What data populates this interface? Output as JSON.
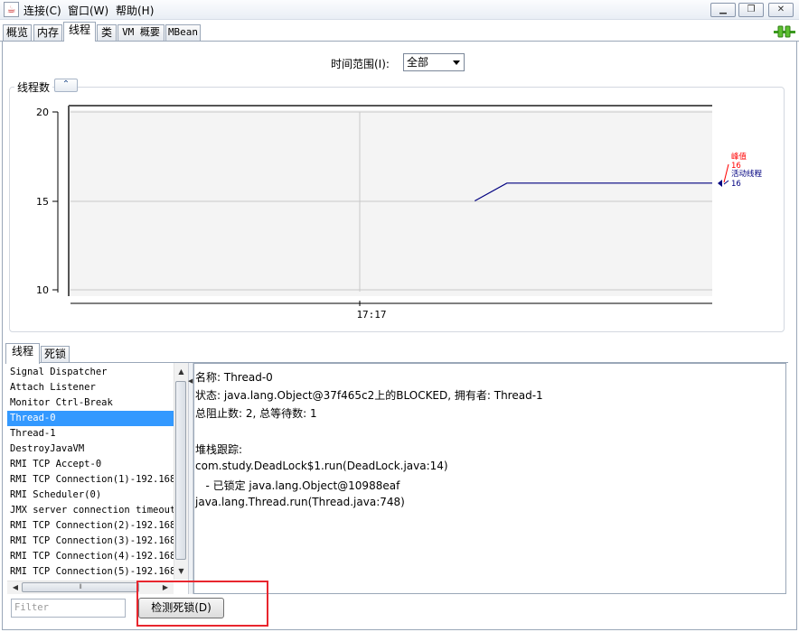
{
  "menubar": {
    "java_icon": "java-cup-icon",
    "items": [
      "连接(C)",
      "窗口(W)",
      "帮助(H)"
    ],
    "window_buttons": {
      "minimize": "▁",
      "restore": "❐",
      "close": "✕"
    }
  },
  "tabs": [
    "概览",
    "内存",
    "线程",
    "类",
    "VM 概要",
    "MBean"
  ],
  "active_tab": "线程",
  "connection_icon": "plug-connected-icon",
  "time_range": {
    "label": "时间范围(I):",
    "value": "全部"
  },
  "chart_panel": {
    "title": "线程数",
    "collapse_icon": "double-chevron-up-icon"
  },
  "chart_data": {
    "type": "line",
    "y_ticks": [
      "20",
      "15",
      "10"
    ],
    "x_ticks": [
      "17:17"
    ],
    "ylim": [
      10,
      20
    ],
    "series": [
      {
        "name": "峰值",
        "value": "16",
        "color": "#ff0000",
        "x": [],
        "y": []
      },
      {
        "name": "活动线程",
        "value": "16",
        "color": "#000080",
        "x": [
          0.63,
          0.68,
          1.0
        ],
        "y": [
          15,
          16,
          16
        ]
      }
    ]
  },
  "bottom_tabs": [
    "线程",
    "死锁"
  ],
  "active_bottom_tab": "线程",
  "threads": [
    "Signal Dispatcher",
    "Attach Listener",
    "Monitor Ctrl-Break",
    "Thread-0",
    "Thread-1",
    "DestroyJavaVM",
    "RMI TCP Accept-0",
    "RMI TCP Connection(1)-192.168.",
    "RMI Scheduler(0)",
    "JMX server connection timeout",
    "RMI TCP Connection(2)-192.168.",
    "RMI TCP Connection(3)-192.168.",
    "RMI TCP Connection(4)-192.168.",
    "RMI TCP Connection(5)-192.168."
  ],
  "selected_thread": "Thread-0",
  "details": {
    "name": "名称: Thread-0",
    "state": "状态: java.lang.Object@37f465c2上的BLOCKED, 拥有者: Thread-1",
    "counts": "总阻止数: 2, 总等待数: 1",
    "stack_header": "堆栈跟踪:",
    "stack": [
      "com.study.DeadLock$1.run(DeadLock.java:14)",
      "   - 已锁定 java.lang.Object@10988eaf",
      "java.lang.Thread.run(Thread.java:748)"
    ]
  },
  "filter": {
    "placeholder": "Filter"
  },
  "detect_button": "检测死锁(D)"
}
